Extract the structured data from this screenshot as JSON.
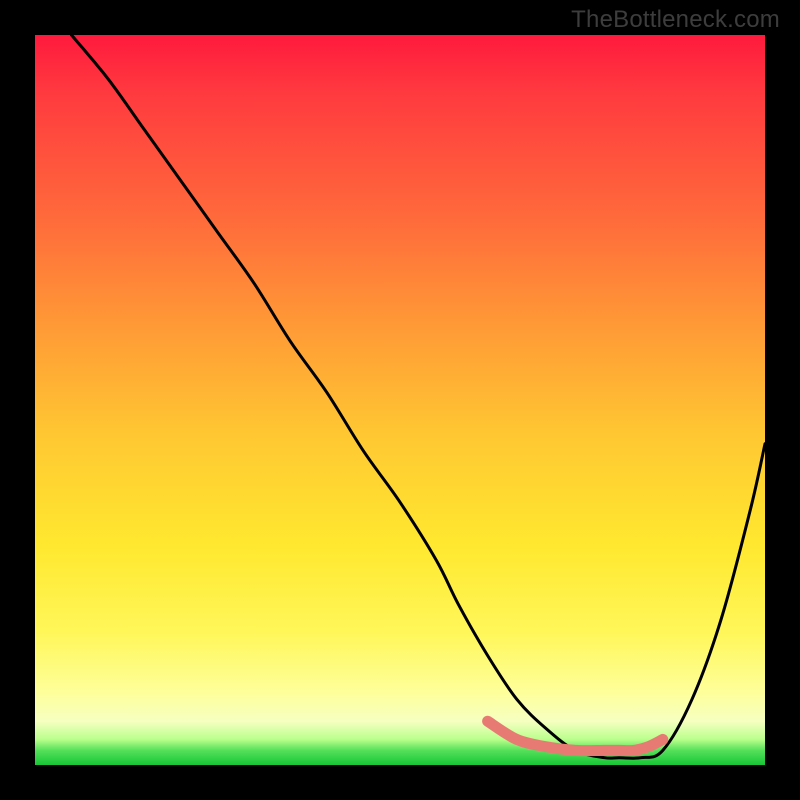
{
  "watermark": "TheBottleneck.com",
  "chart_data": {
    "type": "line",
    "title": "",
    "xlabel": "",
    "ylabel": "",
    "xlim": [
      0,
      100
    ],
    "ylim": [
      0,
      100
    ],
    "series": [
      {
        "name": "bottleneck-curve",
        "x": [
          5,
          10,
          15,
          20,
          25,
          30,
          35,
          40,
          45,
          50,
          55,
          58,
          62,
          66,
          70,
          74,
          78,
          80,
          83,
          86,
          90,
          94,
          98,
          100
        ],
        "values": [
          100,
          94,
          87,
          80,
          73,
          66,
          58,
          51,
          43,
          36,
          28,
          22,
          15,
          9,
          5,
          2,
          1,
          1,
          1,
          2,
          9,
          20,
          35,
          44
        ]
      }
    ],
    "valley_band": {
      "name": "optimal-band-marker",
      "color": "#e77b74",
      "x": [
        62,
        66,
        70,
        74,
        78,
        80,
        82,
        84,
        86
      ],
      "values": [
        6,
        3.5,
        2.5,
        2,
        2,
        2,
        2,
        2.5,
        3.5
      ]
    },
    "gradient_stops": [
      {
        "pos": 0,
        "color": "#ff1a3d"
      },
      {
        "pos": 25,
        "color": "#ff6a3b"
      },
      {
        "pos": 55,
        "color": "#ffc832"
      },
      {
        "pos": 82,
        "color": "#fff75a"
      },
      {
        "pos": 96,
        "color": "#b9ff8c"
      },
      {
        "pos": 100,
        "color": "#17c636"
      }
    ]
  }
}
